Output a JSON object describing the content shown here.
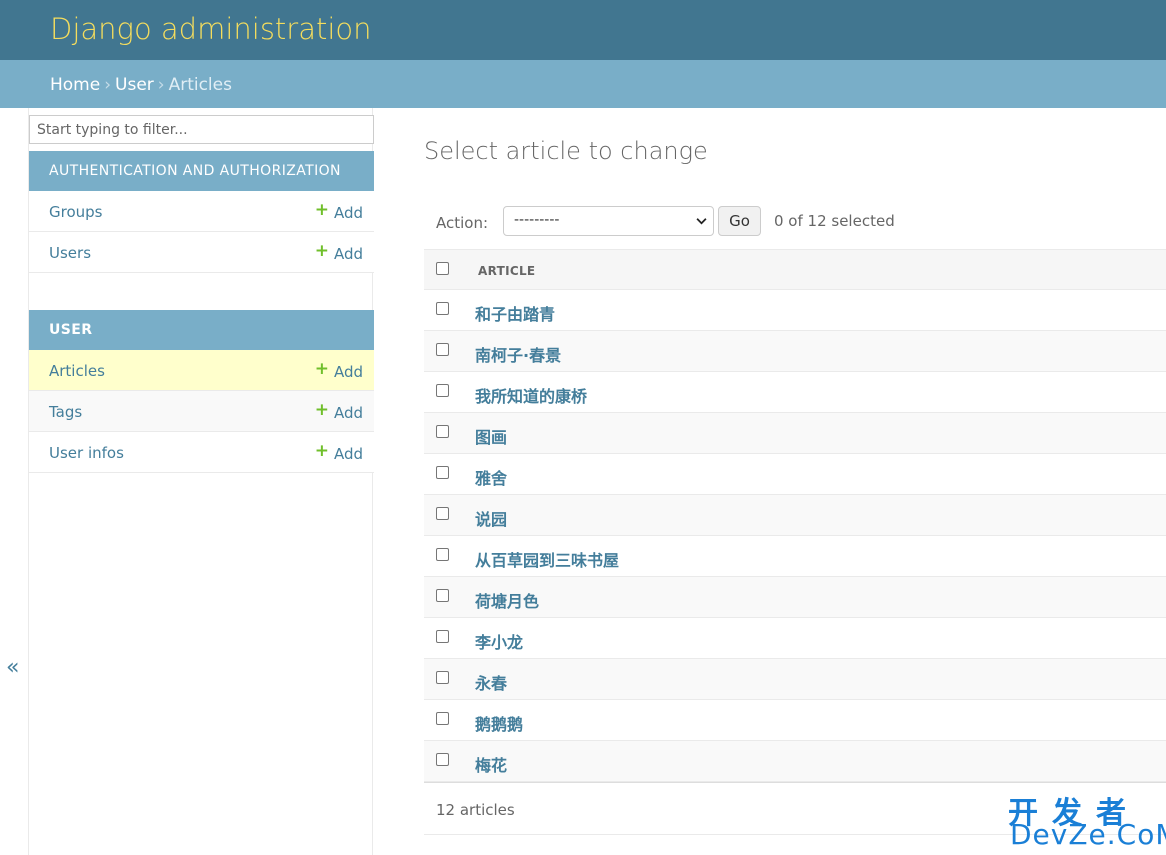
{
  "header": {
    "site_name": "Django administration"
  },
  "breadcrumbs": {
    "home": "Home",
    "app": "User",
    "current": "Articles",
    "separator": "›"
  },
  "sidebar": {
    "filter_placeholder": "Start typing to filter...",
    "toggle_label": "«",
    "modules": [
      {
        "caption": "AUTHENTICATION AND AUTHORIZATION",
        "models": [
          {
            "name": "Groups",
            "add": "Add"
          },
          {
            "name": "Users",
            "add": "Add"
          }
        ]
      },
      {
        "caption": "USER",
        "models": [
          {
            "name": "Articles",
            "add": "Add",
            "current": true
          },
          {
            "name": "Tags",
            "add": "Add"
          },
          {
            "name": "User infos",
            "add": "Add"
          }
        ]
      }
    ]
  },
  "content": {
    "title": "Select article to change",
    "actions": {
      "label": "Action:",
      "selected_value": "---------",
      "go_label": "Go",
      "selected_count": "0 of 12 selected"
    },
    "table": {
      "column_header": "ARTICLE",
      "rows": [
        "和子由踏青",
        "南柯子·春景",
        "我所知道的康桥",
        "图画",
        "雅舍",
        "说园",
        "从百草园到三味书屋",
        "荷塘月色",
        "李小龙",
        "永春",
        "鹅鹅鹅",
        "梅花"
      ]
    },
    "paginator": "12 articles"
  },
  "watermark": {
    "cn": "开发者",
    "en": "DevZe.CoM"
  },
  "colors": {
    "header_bg": "#417690",
    "site_name": "#f5dd5d",
    "breadcrumb_bg": "#79aec8",
    "link": "#447e9b",
    "add_plus": "#70bf2b",
    "current_row_bg": "#ffffcc"
  },
  "icons": {
    "add": "plus-icon",
    "select": "chevron-down-icon",
    "collapse": "double-chevron-left-icon"
  }
}
